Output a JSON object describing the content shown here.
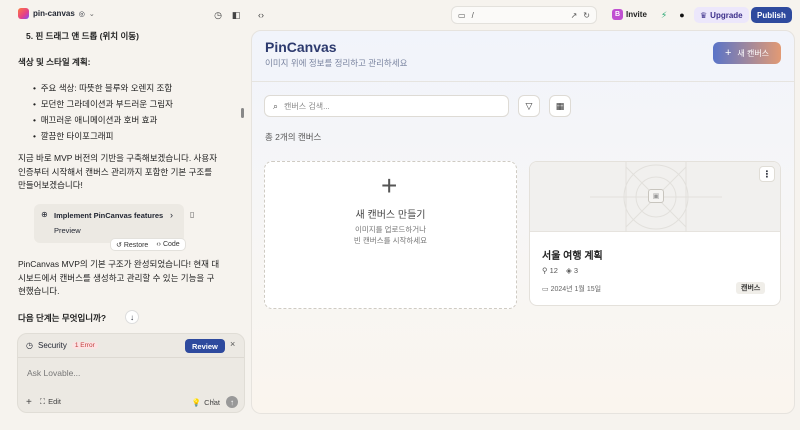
{
  "topbar": {
    "project_name": "pin-canvas",
    "url_path": "/",
    "avatar_letter": "B",
    "invite_label": "Invite",
    "upgrade_label": "Upgrade",
    "publish_label": "Publish"
  },
  "chat": {
    "list_item_5": "5.  핀 드래그 앤 드롭 (위치 이동)",
    "style_heading": "색상 및 스타일 계획:",
    "style_items": [
      "주요 색상: 따뜻한 블루와 오렌지 조합",
      "모던한 그라데이션과 부드러운 그림자",
      "매끄러운 애니메이션과 호버 효과",
      "깔끔한 타이포그래피"
    ],
    "para1_lines": [
      "지금 바로 MVP 버전의 기반을 구축해보겠습니다. 사용자",
      "인증부터 시작해서 캔버스 관리까지 포함한 기본 구조를",
      "만들어보겠습니다!"
    ],
    "impl_card": {
      "title": "Implement PinCanvas features",
      "preview": "Preview",
      "restore": "Restore",
      "code": "Code"
    },
    "para2_lines": [
      "PinCanvas MVP의 기본 구조가 완성되었습니다! 현재 대",
      "시보드에서 캔버스를 생성하고 관리할 수 있는 기능을 구",
      "현했습니다."
    ],
    "next_heading": "다음 단계는 무엇입니까?"
  },
  "composer": {
    "security_label": "Security",
    "error_badge": "1 Error",
    "review_label": "Review",
    "placeholder": "Ask Lovable...",
    "edit_label": "Edit",
    "chat_label": "Chat"
  },
  "app": {
    "title": "PinCanvas",
    "subtitle": "이미지 위에 정보를 정리하고 관리하세요",
    "new_canvas_label": "새 캔버스",
    "search_placeholder": "캔버스 검색...",
    "count_text": "총 2개의 캔버스",
    "new_card": {
      "title": "새 캔버스 만들기",
      "sub_line1": "이미지를 업로드하거나",
      "sub_line2": "빈 캔버스를 시작하세요"
    },
    "canvas_card": {
      "title": "서울 여행 계획",
      "pins": "12",
      "layers": "3",
      "date": "2024년 1월 15일",
      "tag": "캔버스"
    }
  }
}
